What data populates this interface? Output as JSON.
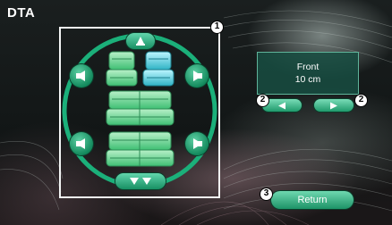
{
  "screen": {
    "title": "DTA"
  },
  "position_panel": {
    "position": "Front",
    "distance": "10 cm"
  },
  "buttons": {
    "return_label": "Return"
  },
  "callouts": [
    "1",
    "2",
    "2",
    "3"
  ],
  "icons": {
    "front_left_speaker": "speaker-left-icon",
    "front_right_speaker": "speaker-right-icon",
    "rear_left_speaker": "speaker-left-icon",
    "rear_right_speaker": "speaker-right-icon",
    "front_seat_button": "seat-up-icon",
    "rear_seat_button": "seat-down-icon",
    "decrease": "arrow-left-icon",
    "increase": "arrow-right-icon"
  },
  "colors": {
    "accent": "#1d9367",
    "ring": "#1bb07a",
    "panel": "#184e42"
  }
}
